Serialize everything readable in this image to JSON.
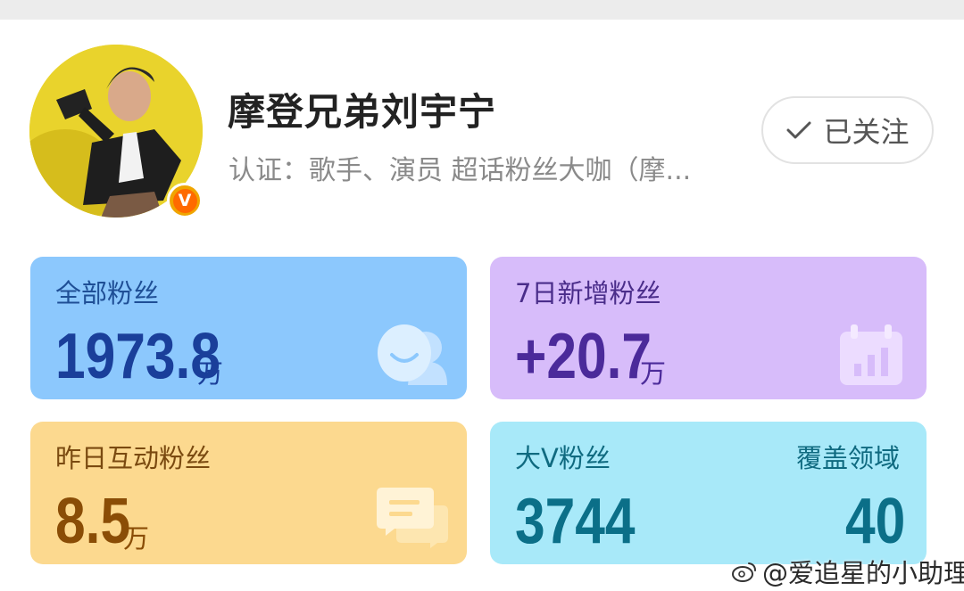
{
  "profile": {
    "name": "摩登兄弟刘宇宁",
    "verification": "认证：歌手、演员 超话粉丝大咖（摩...",
    "badge": "V",
    "follow_label": "已关注"
  },
  "stats": {
    "all_fans": {
      "label": "全部粉丝",
      "value": "1973.8",
      "unit": "万"
    },
    "new_fans_7d": {
      "label": "7日新增粉丝",
      "value": "+20.7",
      "unit": "万"
    },
    "interactive_fans": {
      "label": "昨日互动粉丝",
      "value": "8.5",
      "unit": "万"
    },
    "big_v_fans": {
      "label": "大V粉丝",
      "value": "3744",
      "coverage_label": "覆盖领域",
      "coverage_value": "40"
    }
  },
  "watermark": "@爱追星的小助理",
  "colors": {
    "card_all_fans": "#8cc8fd",
    "card_new_fans": "#d7bcfa",
    "card_interactive": "#fcd98f",
    "card_big_v": "#a8e9f9",
    "verified_badge": "#ff6a00"
  },
  "icons": [
    "fans-icon",
    "calendar-chart-icon",
    "chat-bubbles-icon",
    "checkmark-icon",
    "weibo-icon"
  ]
}
